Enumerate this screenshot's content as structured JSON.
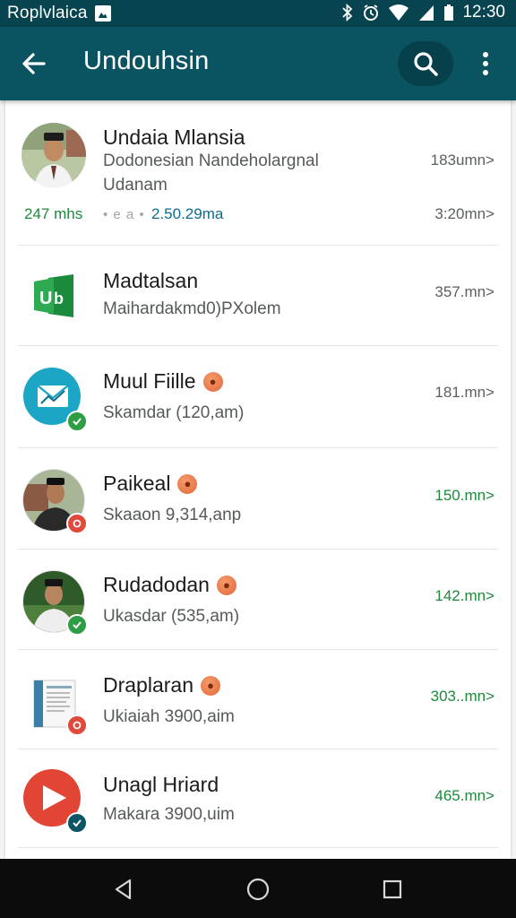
{
  "status_bar": {
    "carrier": "Roplvlaica",
    "time": "12:30"
  },
  "app_bar": {
    "title": "Undouhsin",
    "back_icon": "arrow-left-icon",
    "search_icon": "search-icon",
    "more_icon": "more-vert-icon"
  },
  "items": [
    {
      "title": "Undaia Mlansia",
      "subtitle": "Dodonesian Nandeholargnal",
      "subtitle2": "Udanam",
      "stat_green": "247 mhs",
      "stat_faded": "• e a •",
      "stat_blue": "2.50.29ma",
      "meta": "183umn>",
      "meta2": "3:20mn>",
      "avatar": "person-photo"
    },
    {
      "title": "Madtalsan",
      "subtitle": "Maihardakmd0)PXolem",
      "meta": "357.mn>",
      "avatar": "excel-app-icon"
    },
    {
      "title": "Muul Fiille",
      "subtitle": "Skamdar (120,am)",
      "meta": "181.mn>",
      "avatar": "mail-app-icon",
      "badge": "check-badge"
    },
    {
      "title": "Paikeal",
      "subtitle": "Skaaon 9,314,anp",
      "meta": "150.mn>",
      "avatar": "person-photo",
      "badge": "alert-badge"
    },
    {
      "title": "Rudadodan",
      "subtitle": "Ukasdar (535,am)",
      "meta": "142.mn>",
      "avatar": "person-photo",
      "badge": "check-badge"
    },
    {
      "title": "Draplaran",
      "subtitle": "Ukiaiah 3900,aim",
      "meta": "303..mn>",
      "avatar": "document-icon",
      "badge": "alert-badge"
    },
    {
      "title": "Unagl Hriard",
      "subtitle": "Makara 3900,uim",
      "meta": "465.mn>",
      "avatar": "play-app-icon",
      "badge": "check-badge"
    }
  ],
  "nav_bar": {
    "back_icon": "nav-back-icon",
    "home_icon": "nav-home-icon",
    "recents_icon": "nav-recents-icon"
  },
  "colors": {
    "status_bar": "#07444f",
    "app_bar": "#0a5361",
    "green": "#1d8a3a",
    "blue": "#0e6b8e",
    "badge_green": "#2e9e45",
    "badge_red": "#e14a3b",
    "orange_dot": "#e1683a"
  }
}
